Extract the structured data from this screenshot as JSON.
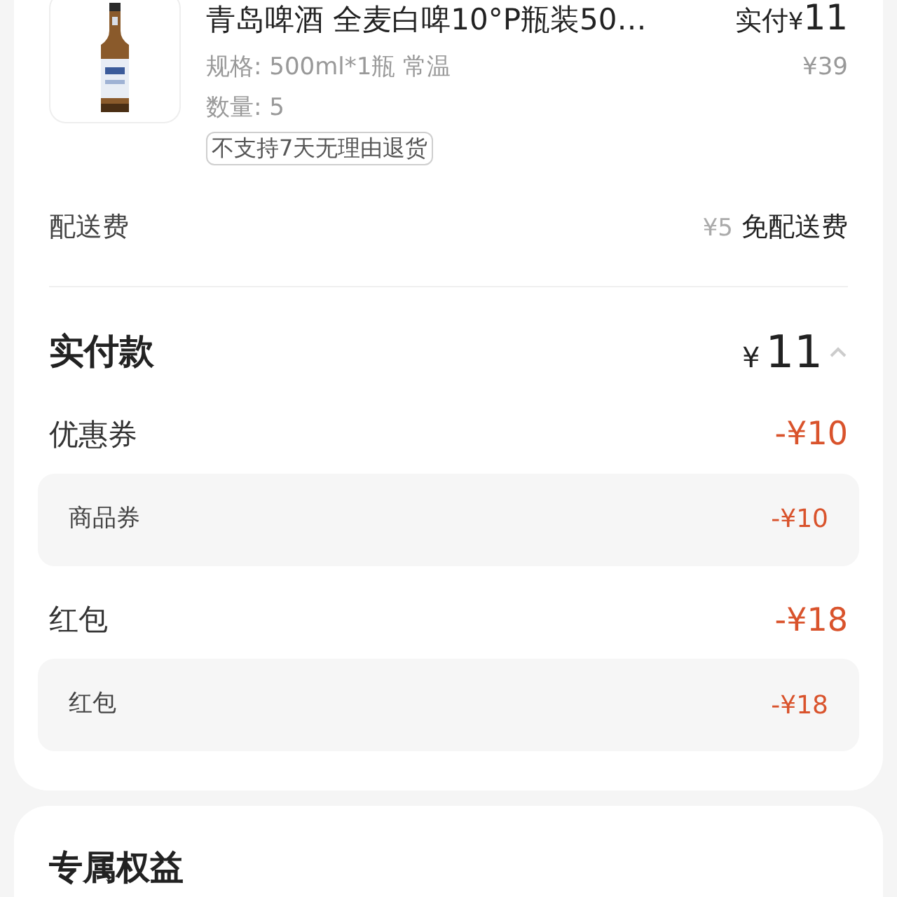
{
  "product": {
    "title": "青岛啤酒 全麦白啤10°P瓶装50…",
    "price_label": "实付",
    "currency": "¥",
    "amount": "11",
    "spec": "规格: 500ml*1瓶 常温",
    "original_price": "¥39",
    "quantity": "数量: 5",
    "tag": "不支持7天无理由退货"
  },
  "delivery": {
    "label": "配送费",
    "original": "¥5",
    "value": "免配送费"
  },
  "total": {
    "label": "实付款",
    "currency": "¥",
    "amount": "11",
    "expanded": true
  },
  "discounts": [
    {
      "label": "优惠券",
      "amount": "-¥10",
      "items": [
        {
          "label": "商品券",
          "amount": "-¥10"
        }
      ]
    },
    {
      "label": "红包",
      "amount": "-¥18",
      "items": [
        {
          "label": "红包",
          "amount": "-¥18"
        }
      ]
    }
  ],
  "next_section": {
    "title": "专属权益"
  }
}
